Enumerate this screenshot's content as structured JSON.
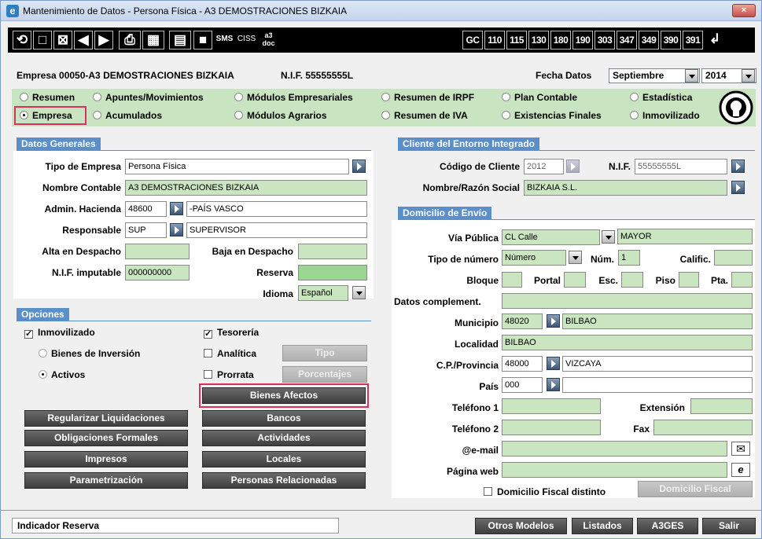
{
  "window": {
    "title": "Mantenimiento de Datos - Persona Física - A3 DEMOSTRACIONES BIZKAIA",
    "close_label": "×",
    "app_icon": "e"
  },
  "toolbar": {
    "icons": [
      "refresh-icon",
      "new-icon",
      "delete-icon",
      "prev-icon",
      "next-icon",
      "print-icon",
      "printer-preview-icon",
      "calculator-icon",
      "save-icon"
    ],
    "sms": "SMS",
    "ciss": "CISS",
    "a3doc": "a3 doc",
    "models": [
      "GC",
      "110",
      "115",
      "130",
      "180",
      "190",
      "303",
      "347",
      "349",
      "390",
      "391"
    ],
    "return_icon": "return-icon"
  },
  "header": {
    "empresa": "Empresa 00050-A3 DEMOSTRACIONES BIZKAIA",
    "nif": "N.I.F. 55555555L",
    "fecha_label": "Fecha Datos",
    "month": "Septiembre",
    "year": "2014"
  },
  "radios": [
    {
      "label": "Resumen",
      "checked": false
    },
    {
      "label": "Apuntes/Movimientos",
      "checked": false
    },
    {
      "label": "Módulos Empresariales",
      "checked": false
    },
    {
      "label": "Resumen de IRPF",
      "checked": false
    },
    {
      "label": "Plan Contable",
      "checked": false
    },
    {
      "label": "Estadística",
      "checked": false
    },
    {
      "label": "Empresa",
      "checked": true
    },
    {
      "label": "Acumulados",
      "checked": false
    },
    {
      "label": "Módulos Agrarios",
      "checked": false
    },
    {
      "label": "Resumen de IVA",
      "checked": false
    },
    {
      "label": "Existencias Finales",
      "checked": false
    },
    {
      "label": "Inmovilizado",
      "checked": false
    }
  ],
  "datos_generales": {
    "title": "Datos Generales",
    "tipo_empresa_label": "Tipo de Empresa",
    "tipo_empresa": "Persona Física",
    "nombre_contable_label": "Nombre Contable",
    "nombre_contable": "A3 DEMOSTRACIONES BIZKAIA",
    "admin_label": "Admin. Hacienda",
    "admin_code": "48600",
    "admin_name": "-PAÍS VASCO",
    "responsable_label": "Responsable",
    "resp_code": "SUP",
    "resp_name": "SUPERVISOR",
    "alta_label": "Alta en Despacho",
    "baja_label": "Baja en Despacho",
    "nif_imp_label": "N.I.F. imputable",
    "nif_imp": "000000000",
    "reserva_label": "Reserva",
    "idioma_label": "Idioma",
    "idioma": "Español"
  },
  "opciones": {
    "title": "Opciones",
    "inmovilizado": "Inmovilizado",
    "bienes_inversion": "Bienes de Inversión",
    "activos": "Activos",
    "tesoreria": "Tesorería",
    "analitica": "Analítica",
    "prorrata": "Prorrata",
    "tipo_btn": "Tipo",
    "porcentajes_btn": "Porcentajes",
    "bienes_afectos_btn": "Bienes Afectos",
    "buttons_left": [
      "Regularizar Liquidaciones",
      "Obligaciones Formales",
      "Impresos",
      "Parametrización"
    ],
    "buttons_right": [
      "Bancos",
      "Actividades",
      "Locales",
      "Personas Relacionadas"
    ]
  },
  "cliente": {
    "title": "Cliente del Entorno Integrado",
    "codigo_label": "Código de Cliente",
    "codigo": "2012",
    "nif_label": "N.I.F.",
    "nif": "55555555L",
    "nombre_label": "Nombre/Razón Social",
    "nombre": "BIZKAIA S.L."
  },
  "domicilio": {
    "title": "Domicilio de Envío",
    "via_label": "Vía Pública",
    "via_tipo": "CL Calle",
    "via_nombre": "MAYOR",
    "tipo_num_label": "Tipo de número",
    "tipo_num": "Número",
    "num_label": "Núm.",
    "num": "1",
    "calific_label": "Calific.",
    "bloque_label": "Bloque",
    "portal_label": "Portal",
    "esc_label": "Esc.",
    "piso_label": "Piso",
    "pta_label": "Pta.",
    "datos_comp_label": "Datos complement.",
    "municipio_label": "Municipio",
    "municipio_code": "48020",
    "municipio_name": "BILBAO",
    "localidad_label": "Localidad",
    "localidad": "BILBAO",
    "cp_label": "C.P./Provincia",
    "cp": "48000",
    "provincia": "VIZCAYA",
    "pais_label": "País",
    "pais": "000",
    "tel1_label": "Teléfono 1",
    "extension_label": "Extensión",
    "tel2_label": "Teléfono 2",
    "fax_label": "Fax",
    "email_label": "@e-mail",
    "web_label": "Página web",
    "dom_fiscal_chk": "Domicilio Fiscal distinto",
    "dom_fiscal_btn": "Domicilio Fiscal"
  },
  "footer": {
    "status": "Indicador Reserva",
    "buttons": [
      "Otros Modelos",
      "Listados",
      "A3GES",
      "Salir"
    ]
  }
}
